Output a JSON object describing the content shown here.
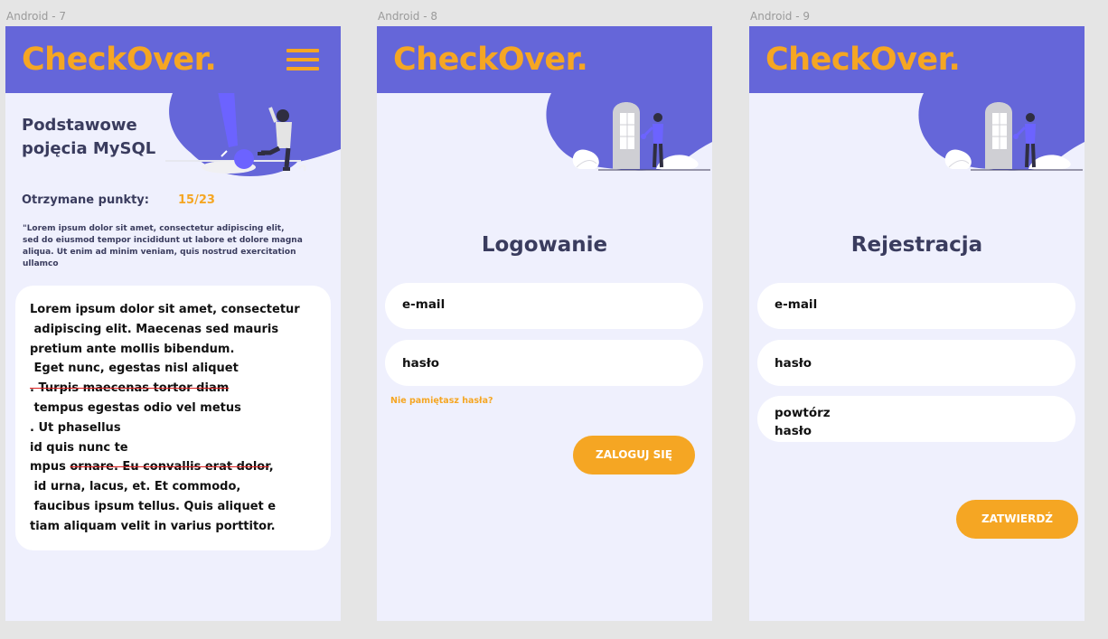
{
  "frames": [
    {
      "label": "Android - 7"
    },
    {
      "label": "Android - 8"
    },
    {
      "label": "Android - 9"
    }
  ],
  "app": {
    "logo": "CheckOver."
  },
  "quiz": {
    "title_line1": "Podstawowe",
    "title_line2": "pojęcia MySQL",
    "points_label": "Otrzymane punkty:",
    "points_value": "15/23",
    "quote": "\"Lorem ipsum dolor sit amet, consectetur adipiscing elit, sed do eiusmod tempor incididunt ut labore et dolore magna aliqua. Ut enim ad minim veniam, quis nostrud exercitation ullamco",
    "text_lines": [
      "Lorem ipsum dolor sit amet, consectetur",
      " adipiscing elit. Maecenas sed mauris",
      "pretium ante mollis bibendum.",
      " Eget nunc, egestas nisl aliquet",
      ". Turpis maecenas tortor diam",
      " tempus egestas odio vel metus",
      ". Ut phasellus",
      "id quis nunc te",
      "mpus ",
      "ornare. Eu convallis erat dolor",
      ",",
      " id urna, lacus, et. Et commodo,",
      " faucibus ipsum tellus. Quis aliquet e",
      "tiam aliquam velit in varius porttitor."
    ]
  },
  "login": {
    "title": "Logowanie",
    "email_placeholder": "e-mail",
    "password_placeholder": "hasło",
    "forgot_link": "Nie pamiętasz hasła?",
    "submit": "ZALOGUJ SIĘ"
  },
  "register": {
    "title": "Rejestracja",
    "email_placeholder": "e-mail",
    "password_placeholder": "hasło",
    "repeat_line1": "powtórz",
    "repeat_line2": "hasło",
    "submit": "ZATWIERDŹ"
  },
  "colors": {
    "header": "#6566d9",
    "accent": "#f5a623",
    "frame_bg": "#eff0fd",
    "heading": "#3a3c5e",
    "strike": "#e02020"
  },
  "icons": [
    "hamburger-menu-icon",
    "exclamation-person-illustration",
    "door-person-illustration"
  ]
}
